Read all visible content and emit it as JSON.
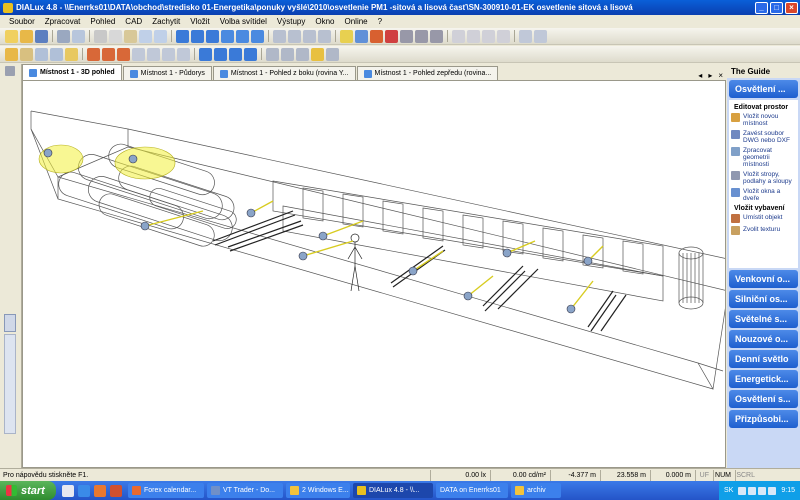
{
  "window": {
    "title": "DIALux 4.8 - \\\\Enerrks01\\DATA\\obchod\\stredisko 01-Energetika\\ponuky vyšlé\\2010\\osvetlenie PM1 -sitová a lisová časť\\SN-300910-01-EK osvetlenie sitová a lisová"
  },
  "menu": [
    "Soubor",
    "Zpracovat",
    "Pohled",
    "CAD",
    "Zachytit",
    "Vložit",
    "Volba svítidel",
    "Výstupy",
    "Okno",
    "Online",
    "?"
  ],
  "tabs": [
    {
      "label": "Místnost 1 - 3D pohled",
      "active": true
    },
    {
      "label": "Místnost 1 - Půdorys",
      "active": false
    },
    {
      "label": "Místnost 1 - Pohled z boku (rovina Y...",
      "active": false
    },
    {
      "label": "Místnost 1 - Pohled zepředu (rovina...",
      "active": false
    }
  ],
  "guide": {
    "title": "The Guide",
    "top_section": "Osvětlení ...",
    "panel_heading1": "Editovat prostor",
    "actions1": [
      "Vložit novou místnost",
      "Zavést soubor DWG nebo DXF",
      "Zpracovat geometrii místnosti",
      "Vložit stropy, podlahy a sloupy",
      "Vložit okna a dveře"
    ],
    "panel_heading2": "Vložit vybavení",
    "actions2": [
      "Umístit objekt",
      "Zvolit texturu"
    ],
    "sections": [
      "Venkovní o...",
      "Silniční os...",
      "Světelné s...",
      "Nouzové o...",
      "Denní světlo",
      "Energetick...",
      "Osvětlení s...",
      "Přizpůsobi..."
    ]
  },
  "status": {
    "help": "Pro nápovědu stiskněte F1.",
    "lx": "0.00 lx",
    "cdm2": "0.00 cd/m²",
    "x": "-4.377 m",
    "y": "23.558 m",
    "z": "0.000 m",
    "flags": [
      "UF",
      "NUM",
      "SCRL"
    ]
  },
  "taskbar": {
    "start": "start",
    "tasks": [
      {
        "label": "Forex calendar...",
        "active": false
      },
      {
        "label": "VT Trader - Do...",
        "active": false
      },
      {
        "label": "2 Windows E...",
        "active": false
      },
      {
        "label": "DIALux 4.8 - \\\\...",
        "active": true
      },
      {
        "label": "DATA on Enerrks01",
        "active": false
      },
      {
        "label": "archiv",
        "active": false
      }
    ],
    "lang": "SK",
    "clock": "9:15"
  },
  "colors": {
    "title_bar": "#0a4fc8",
    "guide_section": "#2d6bd6",
    "light_cone": "#f2f03a"
  }
}
